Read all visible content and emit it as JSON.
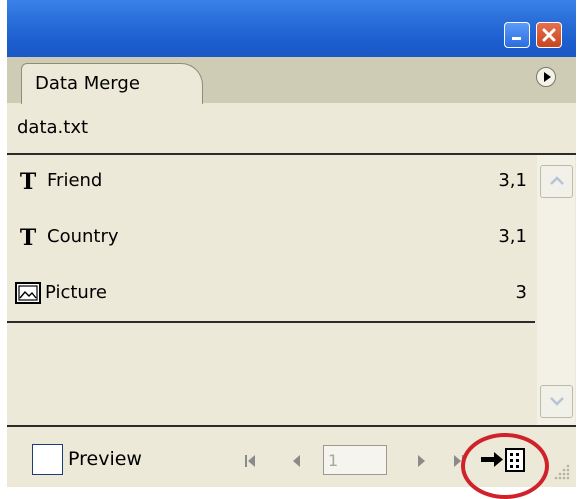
{
  "panel": {
    "tab_label": "Data Merge",
    "source_file": "data.txt"
  },
  "fields": [
    {
      "name": "Friend",
      "type": "text",
      "icon": "text-field-icon",
      "value": "3,1"
    },
    {
      "name": "Country",
      "type": "text",
      "icon": "text-field-icon",
      "value": "3,1"
    },
    {
      "name": "Picture",
      "type": "image",
      "icon": "image-field-icon",
      "value": "3"
    }
  ],
  "icons": {
    "text_glyph": "T"
  },
  "footer": {
    "preview_label": "Preview",
    "preview_checked": false,
    "record_number": "1"
  },
  "colors": {
    "titlebar": "#2a6fd9",
    "panel_bg": "#ece9d8",
    "highlight_circle": "#d0222a"
  }
}
